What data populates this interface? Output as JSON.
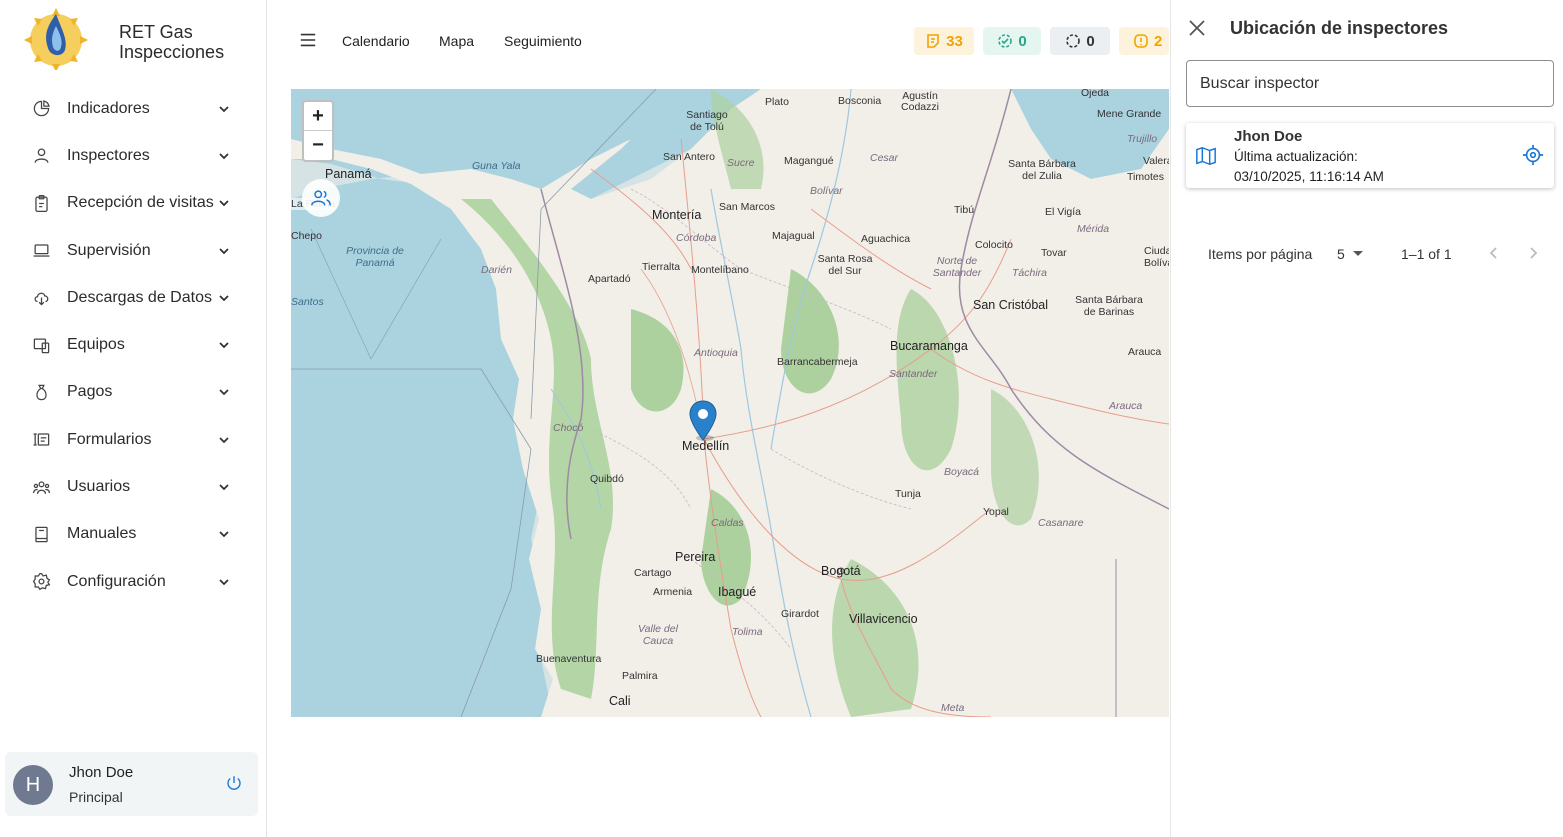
{
  "brand": {
    "line1": "RET Gas",
    "line2": "Inspecciones"
  },
  "nav": [
    {
      "label": "Indicadores",
      "icon": "chart-pie-icon"
    },
    {
      "label": "Inspectores",
      "icon": "user-icon"
    },
    {
      "label": "Recepción de visitas",
      "icon": "clipboard-icon"
    },
    {
      "label": "Supervisión",
      "icon": "laptop-icon"
    },
    {
      "label": "Descargas de Datos",
      "icon": "cloud-download-icon"
    },
    {
      "label": "Equipos",
      "icon": "devices-icon"
    },
    {
      "label": "Pagos",
      "icon": "money-bag-icon"
    },
    {
      "label": "Formularios",
      "icon": "form-icon"
    },
    {
      "label": "Usuarios",
      "icon": "users-icon"
    },
    {
      "label": "Manuales",
      "icon": "book-icon"
    },
    {
      "label": "Configuración",
      "icon": "gear-icon"
    }
  ],
  "user": {
    "initial": "H",
    "name": "Jhon Doe",
    "role": "Principal"
  },
  "topbar": {
    "links": [
      "Calendario",
      "Mapa",
      "Seguimiento"
    ],
    "badges": [
      {
        "value": "33",
        "icon": "note-icon",
        "color": "#f0a500",
        "bg": "#fdf3dc"
      },
      {
        "value": "0",
        "icon": "dashed-check-icon",
        "color": "#2aa58c",
        "bg": "#e5f6f1"
      },
      {
        "value": "0",
        "icon": "dashed-circle-icon",
        "color": "#333333",
        "bg": "#eceff1"
      },
      {
        "value": "2",
        "icon": "alert-icon",
        "color": "#f0a500",
        "bg": "#fdf3dc"
      }
    ]
  },
  "map": {
    "labels": {
      "cities": [
        "Panamá",
        "Montería",
        "Medellín",
        "Bucaramanga",
        "San Cristóbal",
        "Bogotá",
        "Villavicencio",
        "Pereira",
        "Ibagué",
        "Cali"
      ],
      "towns": [
        "Plato",
        "Bosconia",
        "Agustín Codazzi",
        "Ojeda",
        "Mene Grande",
        "Santiago de Tolú",
        "San Antero",
        "Magangué",
        "Santa Bárbara del Zulia",
        "Valera",
        "Timotes",
        "San Marcos",
        "Majagual",
        "Aguachica",
        "Tibú",
        "El Vigía",
        "Tierralta",
        "Montelíbano",
        "Santa Rosa del Sur",
        "Colocito",
        "Tovar",
        "Ciudad Bolívar",
        "Apartadó",
        "Santa Bárbara de Barinas",
        "Barrancabermeja",
        "Arauca",
        "Quibdó",
        "Tunja",
        "Yopal",
        "Cartago",
        "Armenia",
        "Girardot",
        "Buenaventura",
        "Palmira",
        "La Palma",
        "Chepo"
      ],
      "regions": [
        "Guna Yala",
        "Sucre",
        "Cesar",
        "Trujillo",
        "Bolívar",
        "Córdoba",
        "Mérida",
        "Norte de Santander",
        "Táchira",
        "Darién",
        "Provincia de Panamá",
        "Antioquia",
        "Santander",
        "Arauca",
        "Chocó",
        "Boyacá",
        "Casanare",
        "Caldas",
        "Valle del Cauca",
        "Tolima",
        "Meta",
        "Santos"
      ]
    },
    "zoom_in": "+",
    "zoom_out": "−"
  },
  "panel": {
    "title": "Ubicación de inspectores",
    "search_placeholder": "Buscar inspector",
    "inspector": {
      "name": "Jhon Doe",
      "updated_label": "Última actualización:",
      "updated_time": "03/10/2025, 11:16:14 AM"
    },
    "pager": {
      "label": "Items por página",
      "size": "5",
      "range": "1–1 of 1"
    }
  }
}
